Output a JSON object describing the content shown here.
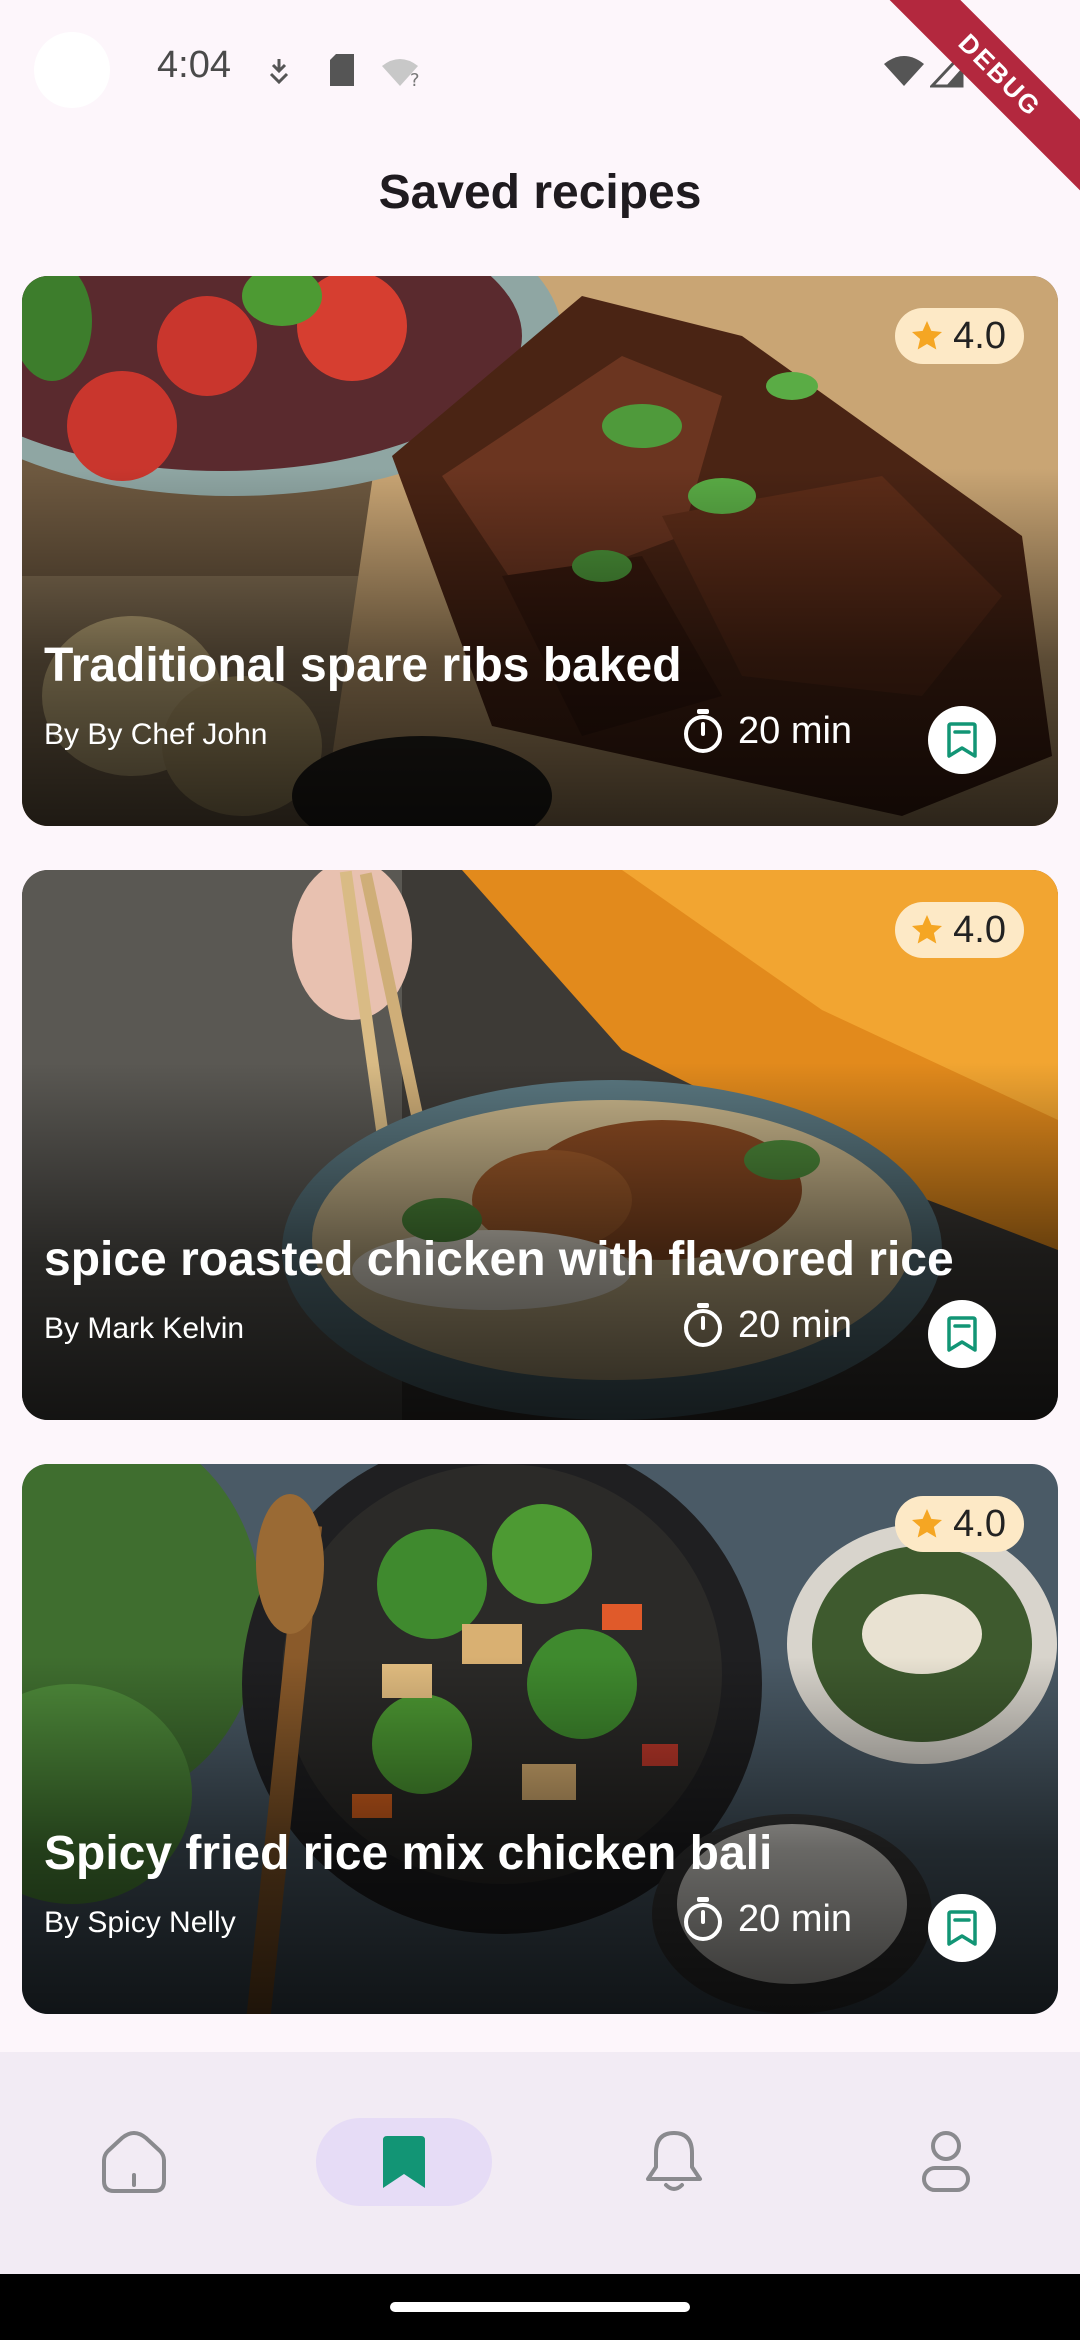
{
  "status_bar": {
    "time": "4:04",
    "icons": [
      "camera-dot",
      "download-shield-icon",
      "sd-card-icon",
      "wifi-question-icon",
      "wifi-icon",
      "signal-icon",
      "battery-icon"
    ]
  },
  "debug_banner": "DEBUG",
  "page": {
    "title": "Saved recipes"
  },
  "recipes": [
    {
      "title": "Traditional spare ribs baked",
      "author": "By By Chef John",
      "rating": "4.0",
      "time": "20 min",
      "saved": true
    },
    {
      "title": "spice roasted chicken with flavored rice",
      "author": "By Mark Kelvin",
      "rating": "4.0",
      "time": "20 min",
      "saved": true
    },
    {
      "title": "Spicy fried rice mix chicken bali",
      "author": "By Spicy Nelly",
      "rating": "4.0",
      "time": "20 min",
      "saved": true
    }
  ],
  "bottom_nav": {
    "items": [
      {
        "icon": "home-icon",
        "active": false
      },
      {
        "icon": "bookmark-icon",
        "active": true
      },
      {
        "icon": "bell-icon",
        "active": false
      },
      {
        "icon": "profile-icon",
        "active": false
      }
    ]
  },
  "colors": {
    "accent_green": "#129575",
    "rating_bg": "#fde9c6",
    "star": "#f5a623",
    "nav_active_bg": "#e6dcf6"
  }
}
